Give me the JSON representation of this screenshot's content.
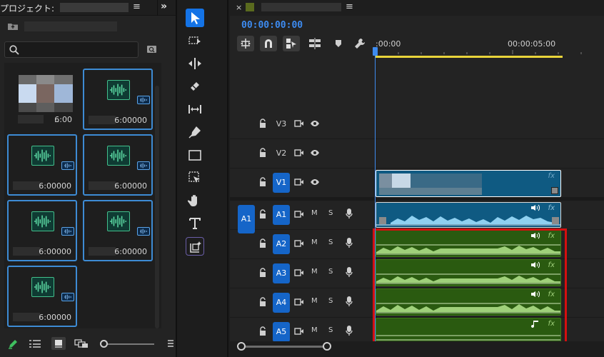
{
  "project": {
    "title": "プロジェクト:",
    "menu": "≡",
    "collapse": "»",
    "search_placeholder": "",
    "items": [
      {
        "type": "video",
        "duration": "6:00",
        "prefix": "..",
        "selected": false
      },
      {
        "type": "audio",
        "duration": "6:00000",
        "selected": true
      },
      {
        "type": "audio",
        "duration": "6:00000",
        "selected": true
      },
      {
        "type": "audio",
        "duration": "6:00000",
        "selected": true
      },
      {
        "type": "audio",
        "duration": "6:00000",
        "selected": true
      },
      {
        "type": "audio",
        "duration": "6:00000",
        "selected": true
      },
      {
        "type": "audio",
        "duration": "6:00000",
        "selected": true
      }
    ]
  },
  "timeline": {
    "close": "×",
    "menu": "≡",
    "timecode": "00:00:00:00",
    "ruler": {
      "start": ":00:00",
      "mid": "00:00:05:00"
    },
    "video_tracks": [
      {
        "name": "V3",
        "targeted": false
      },
      {
        "name": "V2",
        "targeted": false
      },
      {
        "name": "V1",
        "targeted": true
      }
    ],
    "audio_tracks": [
      {
        "name": "A1",
        "targeted": true,
        "source": "A1"
      },
      {
        "name": "A2",
        "targeted": true
      },
      {
        "name": "A3",
        "targeted": true
      },
      {
        "name": "A4",
        "targeted": true
      },
      {
        "name": "A5",
        "targeted": true
      }
    ],
    "mute_label": "M",
    "solo_label": "S",
    "fx_label": "fx",
    "colors": {
      "accent": "#1473e6",
      "video_clip": "#0f5a82",
      "audio_clip": "#2a5a10",
      "selection": "#d40f0f",
      "work_area": "#e8d43a",
      "timecode": "#3d8bf0"
    }
  },
  "tools": [
    "selection-tool-icon",
    "track-select-tool-icon",
    "ripple-edit-tool-icon",
    "razor-tool-icon",
    "slip-tool-icon",
    "pen-tool-icon",
    "rectangle-tool-icon",
    "remix-tool-icon",
    "hand-tool-icon",
    "type-tool-icon",
    "ai-tool-icon"
  ]
}
